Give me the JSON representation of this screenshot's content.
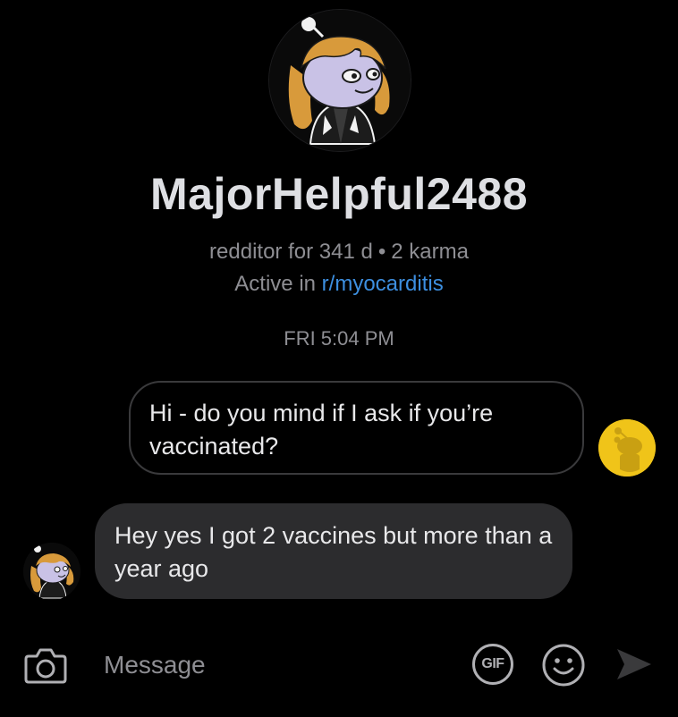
{
  "profile": {
    "username": "MajorHelpful2488",
    "age": "redditor for 341 d",
    "separator": "•",
    "karma": "2 karma",
    "active_prefix": "Active in",
    "active_community": "r/myocarditis",
    "avatar_icon": "snoo-avatar-orange-hair"
  },
  "thread": {
    "timestamp": "FRI 5:04 PM",
    "messages": [
      {
        "sender": "me",
        "text": "Hi - do you mind if I ask if you’re vaccinated?",
        "avatar_icon": "snoo-default-yellow-avatar"
      },
      {
        "sender": "them",
        "text": "Hey yes I got 2 vaccines but more than a year ago",
        "avatar_icon": "snoo-avatar-orange-hair"
      }
    ]
  },
  "composer": {
    "placeholder": "Message",
    "value": "",
    "camera_icon": "camera-icon",
    "gif_label": "GIF",
    "emoji_icon": "smiley-icon",
    "send_icon": "send-arrow-icon"
  },
  "colors": {
    "background": "#000000",
    "link": "#3d8fe0",
    "incoming_bubble": "#2c2c2e",
    "outgoing_border": "#3a3a3c",
    "me_avatar": "#f0c419",
    "secondary_text": "#8e8e93"
  }
}
